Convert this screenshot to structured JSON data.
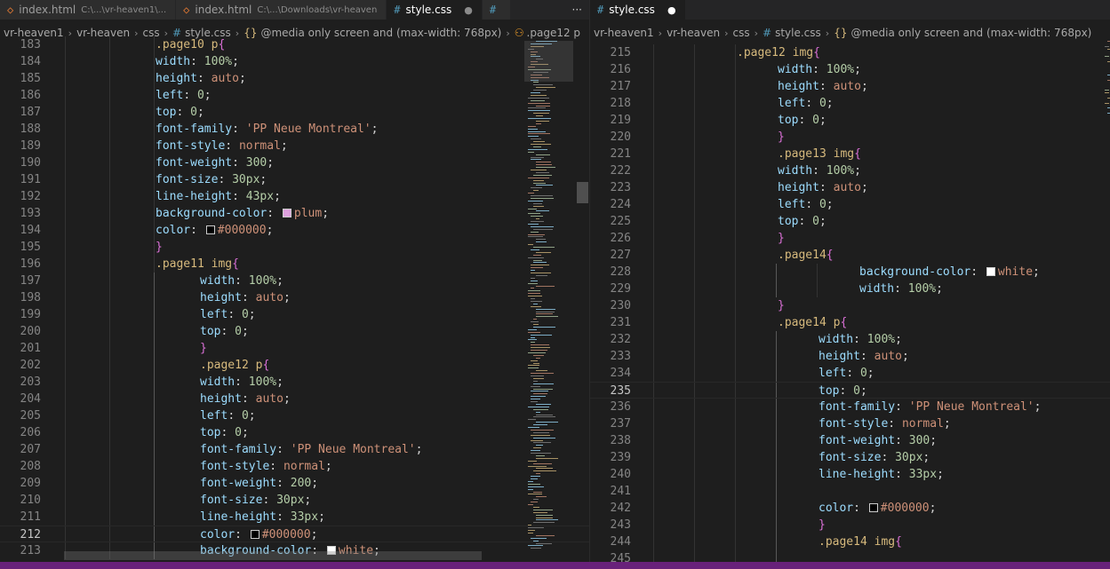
{
  "left_tabs": [
    {
      "name": "index.html",
      "path": "C:\\...\\vr-heaven1\\...",
      "type": "html",
      "active": false
    },
    {
      "name": "index.html",
      "path": "C:\\...\\Downloads\\vr-heaven",
      "type": "html",
      "active": false
    },
    {
      "name": "style.css",
      "path": "",
      "type": "css",
      "active": true,
      "modified": true
    },
    {
      "name": "",
      "path": "",
      "type": "css",
      "active": false
    }
  ],
  "left_more": "···",
  "left_breadcrumb": [
    "vr-heaven1",
    "vr-heaven",
    "css",
    "style.css",
    "@media only screen and (max-width: 768px)",
    ".page12 p"
  ],
  "right_tabs": [
    {
      "name": "style.css",
      "type": "css",
      "active": true,
      "modified": true
    }
  ],
  "right_breadcrumb": [
    "vr-heaven1",
    "vr-heaven",
    "css",
    "style.css",
    "@media only screen and (max-width: 768px)"
  ],
  "left_editor": {
    "current_line": 212,
    "lines": [
      {
        "n": "183",
        "i": 2,
        "t": [
          [
            "sel",
            ".page10 p"
          ],
          [
            "brace",
            "{"
          ]
        ]
      },
      {
        "n": "184",
        "i": 2,
        "t": [
          [
            "prop",
            "width"
          ],
          [
            "punc",
            ": "
          ],
          [
            "num",
            "100%"
          ],
          [
            "punc",
            ";"
          ]
        ]
      },
      {
        "n": "185",
        "i": 2,
        "t": [
          [
            "prop",
            "height"
          ],
          [
            "punc",
            ": "
          ],
          [
            "val",
            "auto"
          ],
          [
            "punc",
            ";"
          ]
        ]
      },
      {
        "n": "186",
        "i": 2,
        "t": [
          [
            "prop",
            "left"
          ],
          [
            "punc",
            ": "
          ],
          [
            "num",
            "0"
          ],
          [
            "punc",
            ";"
          ]
        ]
      },
      {
        "n": "187",
        "i": 2,
        "t": [
          [
            "prop",
            "top"
          ],
          [
            "punc",
            ": "
          ],
          [
            "num",
            "0"
          ],
          [
            "punc",
            ";"
          ]
        ]
      },
      {
        "n": "188",
        "i": 2,
        "t": [
          [
            "prop",
            "font-family"
          ],
          [
            "punc",
            ": "
          ],
          [
            "val",
            "'PP Neue Montreal'"
          ],
          [
            "punc",
            ";"
          ]
        ]
      },
      {
        "n": "189",
        "i": 2,
        "t": [
          [
            "prop",
            "font-style"
          ],
          [
            "punc",
            ": "
          ],
          [
            "val",
            "normal"
          ],
          [
            "punc",
            ";"
          ]
        ]
      },
      {
        "n": "190",
        "i": 2,
        "t": [
          [
            "prop",
            "font-weight"
          ],
          [
            "punc",
            ": "
          ],
          [
            "num",
            "300"
          ],
          [
            "punc",
            ";"
          ]
        ]
      },
      {
        "n": "191",
        "i": 2,
        "t": [
          [
            "prop",
            "font-size"
          ],
          [
            "punc",
            ": "
          ],
          [
            "num",
            "30px"
          ],
          [
            "punc",
            ";"
          ]
        ]
      },
      {
        "n": "192",
        "i": 2,
        "t": [
          [
            "prop",
            "line-height"
          ],
          [
            "punc",
            ": "
          ],
          [
            "num",
            "43px"
          ],
          [
            "punc",
            ";"
          ]
        ]
      },
      {
        "n": "193",
        "i": 2,
        "t": [
          [
            "prop",
            "background-color"
          ],
          [
            "punc",
            ": "
          ],
          [
            "swatch",
            "#dda0dd"
          ],
          [
            "val",
            "plum"
          ],
          [
            "punc",
            ";"
          ]
        ]
      },
      {
        "n": "194",
        "i": 2,
        "t": [
          [
            "prop",
            "color"
          ],
          [
            "punc",
            ": "
          ],
          [
            "swatch",
            "#000000"
          ],
          [
            "val",
            "#000000"
          ],
          [
            "punc",
            ";"
          ]
        ]
      },
      {
        "n": "195",
        "i": 2,
        "t": [
          [
            "brace",
            "}"
          ]
        ]
      },
      {
        "n": "196",
        "i": 2,
        "t": [
          [
            "sel",
            ".page11 img"
          ],
          [
            "brace",
            "{"
          ]
        ]
      },
      {
        "n": "197",
        "i": 3,
        "t": [
          [
            "prop",
            "width"
          ],
          [
            "punc",
            ": "
          ],
          [
            "num",
            "100%"
          ],
          [
            "punc",
            ";"
          ]
        ]
      },
      {
        "n": "198",
        "i": 3,
        "t": [
          [
            "prop",
            "height"
          ],
          [
            "punc",
            ": "
          ],
          [
            "val",
            "auto"
          ],
          [
            "punc",
            ";"
          ]
        ]
      },
      {
        "n": "199",
        "i": 3,
        "t": [
          [
            "prop",
            "left"
          ],
          [
            "punc",
            ": "
          ],
          [
            "num",
            "0"
          ],
          [
            "punc",
            ";"
          ]
        ]
      },
      {
        "n": "200",
        "i": 3,
        "t": [
          [
            "prop",
            "top"
          ],
          [
            "punc",
            ": "
          ],
          [
            "num",
            "0"
          ],
          [
            "punc",
            ";"
          ]
        ]
      },
      {
        "n": "201",
        "i": 3,
        "t": [
          [
            "brace",
            "}"
          ]
        ]
      },
      {
        "n": "202",
        "i": 3,
        "t": [
          [
            "sel",
            ".page12 p"
          ],
          [
            "brace",
            "{"
          ]
        ]
      },
      {
        "n": "203",
        "i": 3,
        "t": [
          [
            "prop",
            "width"
          ],
          [
            "punc",
            ": "
          ],
          [
            "num",
            "100%"
          ],
          [
            "punc",
            ";"
          ]
        ]
      },
      {
        "n": "204",
        "i": 3,
        "t": [
          [
            "prop",
            "height"
          ],
          [
            "punc",
            ": "
          ],
          [
            "val",
            "auto"
          ],
          [
            "punc",
            ";"
          ]
        ]
      },
      {
        "n": "205",
        "i": 3,
        "t": [
          [
            "prop",
            "left"
          ],
          [
            "punc",
            ": "
          ],
          [
            "num",
            "0"
          ],
          [
            "punc",
            ";"
          ]
        ]
      },
      {
        "n": "206",
        "i": 3,
        "t": [
          [
            "prop",
            "top"
          ],
          [
            "punc",
            ": "
          ],
          [
            "num",
            "0"
          ],
          [
            "punc",
            ";"
          ]
        ]
      },
      {
        "n": "207",
        "i": 3,
        "t": [
          [
            "prop",
            "font-family"
          ],
          [
            "punc",
            ": "
          ],
          [
            "val",
            "'PP Neue Montreal'"
          ],
          [
            "punc",
            ";"
          ]
        ]
      },
      {
        "n": "208",
        "i": 3,
        "t": [
          [
            "prop",
            "font-style"
          ],
          [
            "punc",
            ": "
          ],
          [
            "val",
            "normal"
          ],
          [
            "punc",
            ";"
          ]
        ]
      },
      {
        "n": "209",
        "i": 3,
        "t": [
          [
            "prop",
            "font-weight"
          ],
          [
            "punc",
            ": "
          ],
          [
            "num",
            "200"
          ],
          [
            "punc",
            ";"
          ]
        ]
      },
      {
        "n": "210",
        "i": 3,
        "t": [
          [
            "prop",
            "font-size"
          ],
          [
            "punc",
            ": "
          ],
          [
            "num",
            "30px"
          ],
          [
            "punc",
            ";"
          ]
        ]
      },
      {
        "n": "211",
        "i": 3,
        "t": [
          [
            "prop",
            "line-height"
          ],
          [
            "punc",
            ": "
          ],
          [
            "num",
            "33px"
          ],
          [
            "punc",
            ";"
          ]
        ]
      },
      {
        "n": "212",
        "i": 3,
        "t": [
          [
            "prop",
            "color"
          ],
          [
            "punc",
            ": "
          ],
          [
            "swatch",
            "#000000"
          ],
          [
            "val",
            "#000000"
          ],
          [
            "punc",
            ";"
          ]
        ]
      },
      {
        "n": "213",
        "i": 3,
        "t": [
          [
            "prop",
            "background-color"
          ],
          [
            "punc",
            ": "
          ],
          [
            "swatch",
            "#ffffff"
          ],
          [
            "val",
            "white"
          ],
          [
            "punc",
            ";"
          ]
        ]
      }
    ]
  },
  "right_editor": {
    "current_line": 235,
    "lines": [
      {
        "n": "215",
        "i": 2,
        "t": [
          [
            "sel",
            ".page12 img"
          ],
          [
            "brace",
            "{"
          ]
        ]
      },
      {
        "n": "216",
        "i": 3,
        "t": [
          [
            "prop",
            "width"
          ],
          [
            "punc",
            ": "
          ],
          [
            "num",
            "100%"
          ],
          [
            "punc",
            ";"
          ]
        ]
      },
      {
        "n": "217",
        "i": 3,
        "t": [
          [
            "prop",
            "height"
          ],
          [
            "punc",
            ": "
          ],
          [
            "val",
            "auto"
          ],
          [
            "punc",
            ";"
          ]
        ]
      },
      {
        "n": "218",
        "i": 3,
        "t": [
          [
            "prop",
            "left"
          ],
          [
            "punc",
            ": "
          ],
          [
            "num",
            "0"
          ],
          [
            "punc",
            ";"
          ]
        ]
      },
      {
        "n": "219",
        "i": 3,
        "t": [
          [
            "prop",
            "top"
          ],
          [
            "punc",
            ": "
          ],
          [
            "num",
            "0"
          ],
          [
            "punc",
            ";"
          ]
        ]
      },
      {
        "n": "220",
        "i": 3,
        "t": [
          [
            "brace",
            "}"
          ]
        ]
      },
      {
        "n": "221",
        "i": 3,
        "t": [
          [
            "sel",
            ".page13 img"
          ],
          [
            "brace",
            "{"
          ]
        ]
      },
      {
        "n": "222",
        "i": 3,
        "t": [
          [
            "prop",
            "width"
          ],
          [
            "punc",
            ": "
          ],
          [
            "num",
            "100%"
          ],
          [
            "punc",
            ";"
          ]
        ]
      },
      {
        "n": "223",
        "i": 3,
        "t": [
          [
            "prop",
            "height"
          ],
          [
            "punc",
            ": "
          ],
          [
            "val",
            "auto"
          ],
          [
            "punc",
            ";"
          ]
        ]
      },
      {
        "n": "224",
        "i": 3,
        "t": [
          [
            "prop",
            "left"
          ],
          [
            "punc",
            ": "
          ],
          [
            "num",
            "0"
          ],
          [
            "punc",
            ";"
          ]
        ]
      },
      {
        "n": "225",
        "i": 3,
        "t": [
          [
            "prop",
            "top"
          ],
          [
            "punc",
            ": "
          ],
          [
            "num",
            "0"
          ],
          [
            "punc",
            ";"
          ]
        ]
      },
      {
        "n": "226",
        "i": 3,
        "t": [
          [
            "brace",
            "}"
          ]
        ]
      },
      {
        "n": "227",
        "i": 3,
        "t": [
          [
            "sel",
            ".page14"
          ],
          [
            "brace",
            "{"
          ]
        ]
      },
      {
        "n": "228",
        "i": 5,
        "t": [
          [
            "prop",
            "background-color"
          ],
          [
            "punc",
            ": "
          ],
          [
            "swatch",
            "#ffffff"
          ],
          [
            "val",
            "white"
          ],
          [
            "punc",
            ";"
          ]
        ]
      },
      {
        "n": "229",
        "i": 5,
        "t": [
          [
            "prop",
            "width"
          ],
          [
            "punc",
            ": "
          ],
          [
            "num",
            "100%"
          ],
          [
            "punc",
            ";"
          ]
        ]
      },
      {
        "n": "230",
        "i": 3,
        "t": [
          [
            "brace",
            "}"
          ]
        ]
      },
      {
        "n": "231",
        "i": 3,
        "t": [
          [
            "sel",
            ".page14 p"
          ],
          [
            "brace",
            "{"
          ]
        ]
      },
      {
        "n": "232",
        "i": 4,
        "t": [
          [
            "prop",
            "width"
          ],
          [
            "punc",
            ": "
          ],
          [
            "num",
            "100%"
          ],
          [
            "punc",
            ";"
          ]
        ]
      },
      {
        "n": "233",
        "i": 4,
        "t": [
          [
            "prop",
            "height"
          ],
          [
            "punc",
            ": "
          ],
          [
            "val",
            "auto"
          ],
          [
            "punc",
            ";"
          ]
        ]
      },
      {
        "n": "234",
        "i": 4,
        "t": [
          [
            "prop",
            "left"
          ],
          [
            "punc",
            ": "
          ],
          [
            "num",
            "0"
          ],
          [
            "punc",
            ";"
          ]
        ]
      },
      {
        "n": "235",
        "i": 4,
        "t": [
          [
            "prop",
            "top"
          ],
          [
            "punc",
            ": "
          ],
          [
            "num",
            "0"
          ],
          [
            "punc",
            ";"
          ]
        ]
      },
      {
        "n": "236",
        "i": 4,
        "t": [
          [
            "prop",
            "font-family"
          ],
          [
            "punc",
            ": "
          ],
          [
            "val",
            "'PP Neue Montreal'"
          ],
          [
            "punc",
            ";"
          ]
        ]
      },
      {
        "n": "237",
        "i": 4,
        "t": [
          [
            "prop",
            "font-style"
          ],
          [
            "punc",
            ": "
          ],
          [
            "val",
            "normal"
          ],
          [
            "punc",
            ";"
          ]
        ]
      },
      {
        "n": "238",
        "i": 4,
        "t": [
          [
            "prop",
            "font-weight"
          ],
          [
            "punc",
            ": "
          ],
          [
            "num",
            "300"
          ],
          [
            "punc",
            ";"
          ]
        ]
      },
      {
        "n": "239",
        "i": 4,
        "t": [
          [
            "prop",
            "font-size"
          ],
          [
            "punc",
            ": "
          ],
          [
            "num",
            "30px"
          ],
          [
            "punc",
            ";"
          ]
        ]
      },
      {
        "n": "240",
        "i": 4,
        "t": [
          [
            "prop",
            "line-height"
          ],
          [
            "punc",
            ": "
          ],
          [
            "num",
            "33px"
          ],
          [
            "punc",
            ";"
          ]
        ]
      },
      {
        "n": "241",
        "i": 4,
        "t": []
      },
      {
        "n": "242",
        "i": 4,
        "t": [
          [
            "prop",
            "color"
          ],
          [
            "punc",
            ": "
          ],
          [
            "swatch",
            "#000000"
          ],
          [
            "val",
            "#000000"
          ],
          [
            "punc",
            ";"
          ]
        ]
      },
      {
        "n": "243",
        "i": 4,
        "t": [
          [
            "brace",
            "}"
          ]
        ]
      },
      {
        "n": "244",
        "i": 4,
        "t": [
          [
            "sel",
            ".page14 img"
          ],
          [
            "brace",
            "{"
          ]
        ]
      },
      {
        "n": "245",
        "i": 4,
        "t": []
      }
    ]
  },
  "colors": {
    "selector": "#d7ba7d",
    "property": "#9cdcfe",
    "string_value": "#ce9178",
    "number": "#b5cea8",
    "brace": "#da70d6",
    "status_bar": "#68217a",
    "css_icon": "#519aba",
    "html_icon": "#e37933"
  },
  "icons": {
    "html_tab": "html-file-icon",
    "css_tab": "css-hash-icon",
    "modified": "unsaved-dot-icon",
    "more": "more-actions-icon",
    "breadcrumb_brace": "braces-icon",
    "breadcrumb_selector": "css-selector-icon",
    "swatch": "color-swatch-icon"
  }
}
